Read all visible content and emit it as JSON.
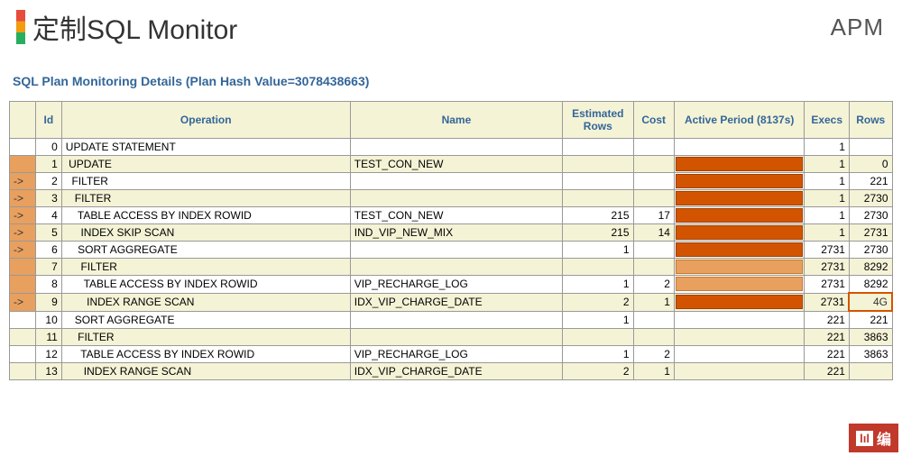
{
  "header": {
    "title": "定制SQL Monitor",
    "logo": "APM"
  },
  "section": {
    "title": "SQL Plan Monitoring Details (Plan Hash Value=3078438663)"
  },
  "columns": {
    "arrow": "",
    "id": "Id",
    "operation": "Operation",
    "name": "Name",
    "estimated": "Estimated Rows",
    "cost": "Cost",
    "active": "Active Period (8137s)",
    "execs": "Execs",
    "rows": "Rows"
  },
  "rows": [
    {
      "arrow": "",
      "arrowBg": false,
      "id": "0",
      "operation": "UPDATE STATEMENT",
      "indent": 0,
      "name": "",
      "est": "",
      "cost": "",
      "bar": "none",
      "execs": "1",
      "rows": "",
      "rowsHighlight": false
    },
    {
      "arrow": "",
      "arrowBg": true,
      "id": "1",
      "operation": "UPDATE",
      "indent": 1,
      "name": "TEST_CON_NEW",
      "est": "",
      "cost": "",
      "bar": "dark",
      "execs": "1",
      "rows": "0",
      "rowsHighlight": false
    },
    {
      "arrow": "->",
      "arrowBg": true,
      "id": "2",
      "operation": "FILTER",
      "indent": 2,
      "name": "",
      "est": "",
      "cost": "",
      "bar": "dark",
      "execs": "1",
      "rows": "221",
      "rowsHighlight": false
    },
    {
      "arrow": "->",
      "arrowBg": true,
      "id": "3",
      "operation": "FILTER",
      "indent": 3,
      "name": "",
      "est": "",
      "cost": "",
      "bar": "dark",
      "execs": "1",
      "rows": "2730",
      "rowsHighlight": false
    },
    {
      "arrow": "->",
      "arrowBg": true,
      "id": "4",
      "operation": "TABLE ACCESS BY INDEX ROWID",
      "indent": 4,
      "name": "TEST_CON_NEW",
      "est": "215",
      "cost": "17",
      "bar": "dark",
      "execs": "1",
      "rows": "2730",
      "rowsHighlight": false
    },
    {
      "arrow": "->",
      "arrowBg": true,
      "id": "5",
      "operation": "INDEX SKIP SCAN",
      "indent": 5,
      "name": "IND_VIP_NEW_MIX",
      "est": "215",
      "cost": "14",
      "bar": "dark",
      "execs": "1",
      "rows": "2731",
      "rowsHighlight": false
    },
    {
      "arrow": "->",
      "arrowBg": true,
      "id": "6",
      "operation": "SORT AGGREGATE",
      "indent": 4,
      "name": "",
      "est": "1",
      "cost": "",
      "bar": "dark",
      "execs": "2731",
      "rows": "2730",
      "rowsHighlight": false
    },
    {
      "arrow": "",
      "arrowBg": true,
      "id": "7",
      "operation": "FILTER",
      "indent": 5,
      "name": "",
      "est": "",
      "cost": "",
      "bar": "light",
      "execs": "2731",
      "rows": "8292",
      "rowsHighlight": false
    },
    {
      "arrow": "",
      "arrowBg": true,
      "id": "8",
      "operation": "TABLE ACCESS BY INDEX ROWID",
      "indent": 6,
      "name": "VIP_RECHARGE_LOG",
      "est": "1",
      "cost": "2",
      "bar": "light",
      "execs": "2731",
      "rows": "8292",
      "rowsHighlight": false
    },
    {
      "arrow": "->",
      "arrowBg": true,
      "id": "9",
      "operation": "INDEX RANGE SCAN",
      "indent": 7,
      "name": "IDX_VIP_CHARGE_DATE",
      "est": "2",
      "cost": "1",
      "bar": "dark",
      "execs": "2731",
      "rows": "4G",
      "rowsHighlight": true
    },
    {
      "arrow": "",
      "arrowBg": false,
      "id": "10",
      "operation": "SORT AGGREGATE",
      "indent": 3,
      "name": "",
      "est": "1",
      "cost": "",
      "bar": "none",
      "execs": "221",
      "rows": "221",
      "rowsHighlight": false
    },
    {
      "arrow": "",
      "arrowBg": false,
      "id": "11",
      "operation": "FILTER",
      "indent": 4,
      "name": "",
      "est": "",
      "cost": "",
      "bar": "none",
      "execs": "221",
      "rows": "3863",
      "rowsHighlight": false
    },
    {
      "arrow": "",
      "arrowBg": false,
      "id": "12",
      "operation": "TABLE ACCESS BY INDEX ROWID",
      "indent": 5,
      "name": "VIP_RECHARGE_LOG",
      "est": "1",
      "cost": "2",
      "bar": "none",
      "execs": "221",
      "rows": "3863",
      "rowsHighlight": false
    },
    {
      "arrow": "",
      "arrowBg": false,
      "id": "13",
      "operation": "INDEX RANGE SCAN",
      "indent": 6,
      "name": "IDX_VIP_CHARGE_DATE",
      "est": "2",
      "cost": "1",
      "bar": "none",
      "execs": "221",
      "rows": "",
      "rowsHighlight": false
    }
  ],
  "watermark": {
    "icon": "lıl",
    "text": "编"
  }
}
